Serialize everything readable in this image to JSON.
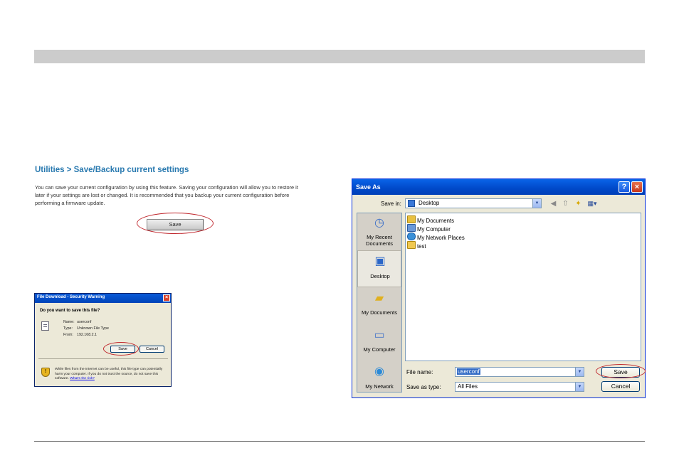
{
  "page": {
    "heading": "Utilities > Save/Backup current settings",
    "body": "You can save your current configuration by using this feature. Saving your configuration will allow you to restore it later if your settings are lost or changed. It is recommended that you backup your current configuration before performing a firmware update.",
    "save_button": "Save"
  },
  "file_download_dialog": {
    "title": "File Download - Security Warning",
    "question": "Do you want to save this file?",
    "name_label": "Name:",
    "name_value": "userconf",
    "type_label": "Type:",
    "type_value": "Unknown File Type",
    "from_label": "From:",
    "from_value": "192.168.2.1",
    "save_button": "Save",
    "cancel_button": "Cancel",
    "warning_text": "While files from the Internet can be useful, this file type can potentially harm your computer. If you do not trust the source, do not save this software.",
    "risk_link": "What's the risk?",
    "icons": {
      "close": "close-icon",
      "file": "file-icon",
      "shield": "shield-warning-icon"
    }
  },
  "save_as_dialog": {
    "title": "Save As",
    "save_in_label": "Save in:",
    "save_in_value": "Desktop",
    "places": [
      {
        "label": "My Recent Documents",
        "icon": "recent-documents-icon"
      },
      {
        "label": "Desktop",
        "icon": "desktop-icon"
      },
      {
        "label": "My Documents",
        "icon": "my-documents-icon"
      },
      {
        "label": "My Computer",
        "icon": "my-computer-icon"
      },
      {
        "label": "My Network",
        "icon": "my-network-icon"
      }
    ],
    "selected_place": "Desktop",
    "files": [
      {
        "name": "My Documents",
        "icon": "folder-documents-icon"
      },
      {
        "name": "My Computer",
        "icon": "computer-icon"
      },
      {
        "name": "My Network Places",
        "icon": "network-places-icon"
      },
      {
        "name": "test",
        "icon": "folder-icon"
      }
    ],
    "file_name_label": "File name:",
    "file_name_value": "userconf",
    "save_as_type_label": "Save as type:",
    "save_as_type_value": "All Files",
    "save_button": "Save",
    "cancel_button": "Cancel",
    "help_button": "?",
    "toolbar_icons": [
      "back-icon",
      "up-folder-icon",
      "new-folder-icon",
      "views-menu-icon"
    ]
  },
  "colors": {
    "heading": "#2a7ab0",
    "highlight_ellipse": "#c0272d",
    "titlebar": "#0a5ad8",
    "dialog_face": "#ece9d8"
  }
}
